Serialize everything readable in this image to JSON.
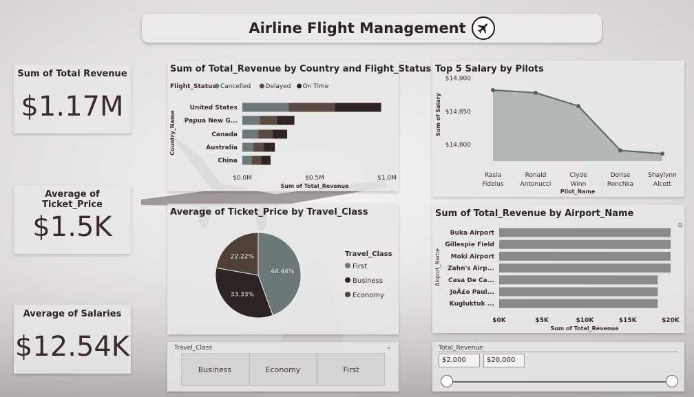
{
  "header": {
    "title": "Airline Flight Management",
    "icon": "airplane-icon"
  },
  "kpis": [
    {
      "label": "Sum of Total Revenue",
      "value": "$1.17M"
    },
    {
      "label": "Average of Ticket_Price",
      "value": "$1.5K"
    },
    {
      "label": "Average of Salaries",
      "value": "$12.54K"
    }
  ],
  "revenue_by_country": {
    "title": "Sum of Total_Revenue by Country and Flight_Status",
    "legend_title": "Flight_Status",
    "legend": [
      "Cancelled",
      "Delayed",
      "On Time"
    ],
    "y_label": "Country_Name",
    "x_label": "Sum of Total_Revenue",
    "ticks": [
      "$0.0M",
      "$0.5M",
      "$1.0M"
    ]
  },
  "pilot_salary": {
    "title": "Top 5 Salary by Pilots",
    "y_label": "Sum of Salary",
    "x_label": "Pilot_Name",
    "ticks": [
      "$14,800",
      "$14,850",
      "$14,900"
    ],
    "pilots": [
      {
        "line1": "Rasia",
        "line2": "Fidelus"
      },
      {
        "line1": "Ronald",
        "line2": "Antonucci"
      },
      {
        "line1": "Clyde",
        "line2": "Winn"
      },
      {
        "line1": "Dorise",
        "line2": "Ronchka"
      },
      {
        "line1": "Shaylynn",
        "line2": "Alcott"
      }
    ]
  },
  "ticket_by_class": {
    "title": "Average of Ticket_Price by Travel_Class",
    "legend_title": "Travel_Class",
    "legend": [
      "First",
      "Business",
      "Economy"
    ],
    "slice_labels": [
      "44.44%",
      "33.33%",
      "22.22%"
    ]
  },
  "revenue_by_airport": {
    "title": "Sum of Total_Revenue by Airport_Name",
    "y_label": "Airport_Name",
    "x_label": "Sum of Total_Revenue",
    "ticks": [
      "$0K",
      "$5K",
      "$10K",
      "$15K",
      "$20K"
    ]
  },
  "class_slicer": {
    "title": "Travel_Class",
    "options": [
      "Business",
      "Economy",
      "First"
    ]
  },
  "revenue_slicer": {
    "title": "Total_Revenue",
    "min": "$2,000",
    "max": "$20,000"
  },
  "colors": {
    "cancelled": "#6b7a78",
    "delayed": "#5a4a42",
    "on_time": "#2f2424",
    "first": "#6b7878",
    "business": "#2f2424",
    "economy": "#4f4038",
    "area": "#a9adad",
    "bar": "#8a8a8a"
  },
  "chart_data": [
    {
      "type": "bar",
      "orientation": "horizontal",
      "stacked": true,
      "title": "Sum of Total_Revenue by Country and Flight_Status",
      "xlabel": "Sum of Total_Revenue",
      "ylabel": "Country_Name",
      "categories": [
        "United States",
        "Papua New G...",
        "Canada",
        "Australia",
        "China"
      ],
      "series": [
        {
          "name": "Cancelled",
          "values": [
            0.32,
            0.12,
            0.11,
            0.075,
            0.065
          ]
        },
        {
          "name": "Delayed",
          "values": [
            0.32,
            0.12,
            0.1,
            0.075,
            0.065
          ]
        },
        {
          "name": "On Time",
          "values": [
            0.32,
            0.12,
            0.1,
            0.075,
            0.065
          ]
        }
      ],
      "xlim": [
        0,
        1.0
      ],
      "unit": "$M",
      "legend_position": "top-left"
    },
    {
      "type": "area",
      "title": "Top 5 Salary by Pilots",
      "xlabel": "Pilot_Name",
      "ylabel": "Sum of Salary",
      "categories": [
        "Rasia Fidelus",
        "Ronald Antonucci",
        "Clyde Winn",
        "Dorise Ronchka",
        "Shaylynn Alcott"
      ],
      "values": [
        14882,
        14878,
        14858,
        14791,
        14786
      ],
      "ylim": [
        14775,
        14910
      ]
    },
    {
      "type": "pie",
      "title": "Average of Ticket_Price by Travel_Class",
      "categories": [
        "First",
        "Business",
        "Economy"
      ],
      "values": [
        44.44,
        33.33,
        22.22
      ],
      "legend_position": "right"
    },
    {
      "type": "bar",
      "orientation": "horizontal",
      "title": "Sum of Total_Revenue by Airport_Name",
      "xlabel": "Sum of Total_Revenue",
      "ylabel": "Airport_Name",
      "categories": [
        "Buka Airport",
        "Gillespie Field",
        "Moki Airport",
        "Zahn's Airp...",
        "Casa De Ca...",
        "JoÃ£o Paul...",
        "Kugluktuk ..."
      ],
      "values": [
        20000,
        20000,
        20000,
        20000,
        18500,
        18500,
        18500
      ],
      "xlim": [
        0,
        20000
      ]
    }
  ]
}
